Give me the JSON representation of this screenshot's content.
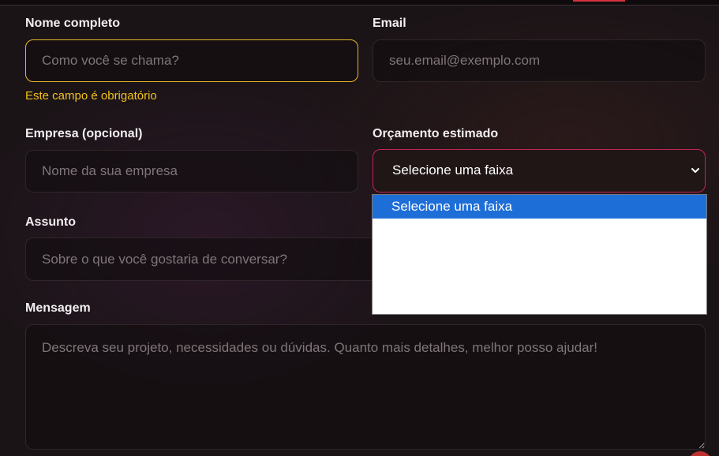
{
  "form": {
    "name": {
      "label": "Nome completo",
      "placeholder": "Como você se chama?",
      "error": "Este campo é obrigatório"
    },
    "email": {
      "label": "Email",
      "placeholder": "seu.email@exemplo.com"
    },
    "company": {
      "label": "Empresa (opcional)",
      "placeholder": "Nome da sua empresa"
    },
    "budget": {
      "label": "Orçamento estimado",
      "selected": "Selecione uma faixa",
      "options": [
        "Selecione uma faixa"
      ]
    },
    "subject": {
      "label": "Assunto",
      "placeholder": "Sobre o que você gostaria de conversar?"
    },
    "message": {
      "label": "Mensagem",
      "placeholder": "Descreva seu projeto, necessidades ou dúvidas. Quanto mais detalhes, melhor posso ajudar!"
    }
  },
  "colors": {
    "error_border": "#e7b72a",
    "error_text": "#f1c21b",
    "select_focus_border": "#c2245c",
    "dropdown_highlight": "#1e6ed8"
  },
  "icons": {
    "select_arrow": "chevron-down-icon"
  }
}
